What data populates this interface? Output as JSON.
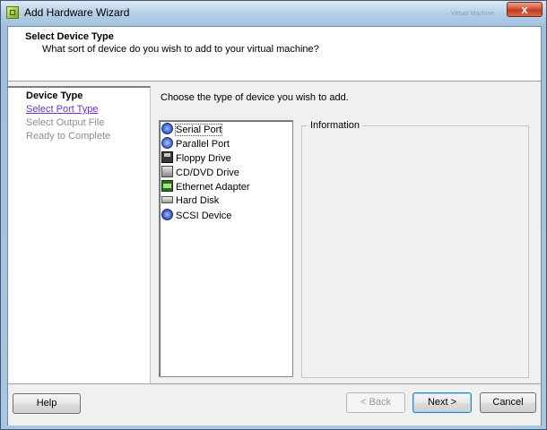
{
  "window": {
    "title": "Add Hardware Wizard",
    "ghost_title": "Virtual Machine",
    "close_label": "x"
  },
  "header": {
    "title": "Select Device Type",
    "subtitle": "What sort of device do you wish to add to your virtual machine?"
  },
  "nav": {
    "items": [
      {
        "label": "Device Type",
        "state": "current"
      },
      {
        "label": "Select Port Type",
        "state": "link"
      },
      {
        "label": "Select Output File",
        "state": "disabled"
      },
      {
        "label": "Ready to Complete",
        "state": "disabled"
      }
    ]
  },
  "main": {
    "prompt": "Choose the type of device you wish to add.",
    "devices": [
      {
        "label": "Serial Port",
        "icon": "serial-port-icon",
        "selected": true
      },
      {
        "label": "Parallel Port",
        "icon": "parallel-port-icon"
      },
      {
        "label": "Floppy Drive",
        "icon": "floppy-drive-icon"
      },
      {
        "label": "CD/DVD Drive",
        "icon": "cd-dvd-drive-icon"
      },
      {
        "label": "Ethernet Adapter",
        "icon": "ethernet-adapter-icon"
      },
      {
        "label": "Hard Disk",
        "icon": "hard-disk-icon"
      },
      {
        "label": "SCSI Device",
        "icon": "scsi-device-icon"
      }
    ],
    "info_label": "Information"
  },
  "footer": {
    "help": "Help",
    "back": "< Back",
    "next": "Next >",
    "cancel": "Cancel"
  }
}
